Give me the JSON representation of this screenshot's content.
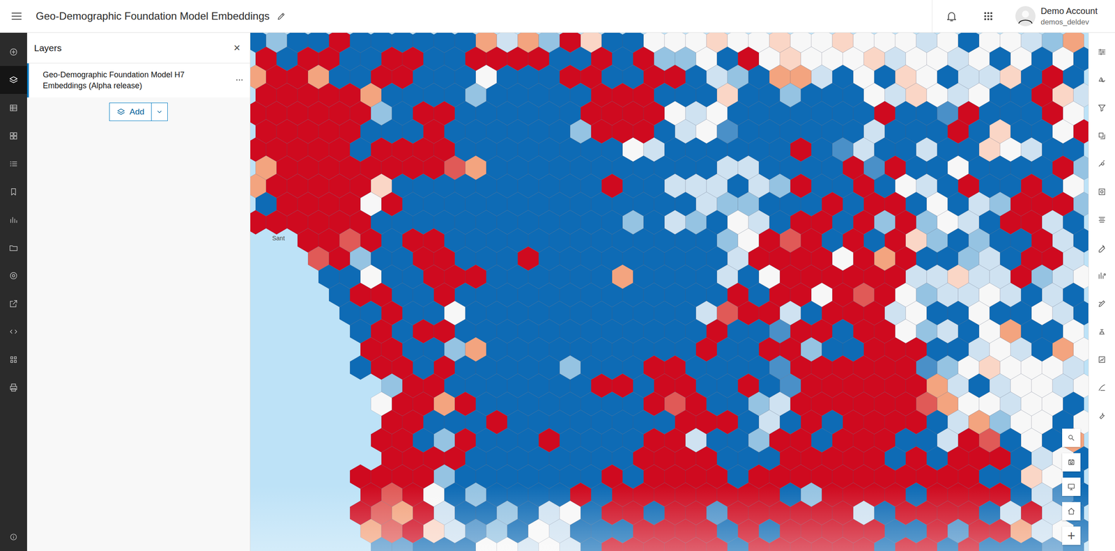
{
  "header": {
    "title": "Geo-Demographic Foundation Model Embeddings",
    "account_name": "Demo Account",
    "account_user": "demos_deldev"
  },
  "left_tools": [
    {
      "selected": false
    },
    {
      "selected": true
    },
    {
      "selected": false
    },
    {
      "selected": false
    },
    {
      "selected": false
    },
    {
      "selected": false
    },
    {
      "selected": false
    },
    {
      "selected": false
    },
    {
      "selected": false
    },
    {
      "selected": false
    },
    {
      "selected": false
    },
    {
      "selected": false
    },
    {
      "selected": false
    }
  ],
  "layers_panel": {
    "title": "Layers",
    "close": "×",
    "layers": [
      {
        "name": "Geo-Demographic Foundation Model H7 Embeddings (Alpha release)",
        "selected": true
      }
    ],
    "add_button": "Add"
  },
  "map": {
    "water": "~",
    "palette": {
      "R": "#cf0a1f",
      "r": "#e05a57",
      "o": "#f3a47f",
      "p": "#fad6c6",
      "w": "#f7f7f7",
      "l": "#cfe2f1",
      "m": "#95c3e2",
      "s": "#4a90c8",
      "B": "#0e6bb5"
    },
    "labels": [
      "Sant"
    ],
    "hex_rows": [
      "BmBBRBBBBBBolomRpBBwwwpwwpwwpwwwlwBwwlmo",
      "RBRRBBRRBBRRRRBBRBRmmwBRwpwwwplwwlwBwBwB",
      "oRRoBBRRBBBwBBBRRBBRRBlmBoolBwBpwBllpBRB",
      "RRRRRoBBBBmBBBBBRRRBBBpBBmBBBwlpwlwBBRpl",
      "RRRRRRmBRRBBBBBBRRRRwlwBBBBBBBRBBsRBBBRw",
      "RRRRRBBBRBBBBBBmRRRBlwsBBBBBBlBBBRBpBBwR",
      "RRRRRBRRRRBBBBBBBBwlBBBBBBRBslBBlBBpwlBB",
      "oRRRRRRRRroBBBBBBBBBBBllBBBBRsRBBwBBBBRm",
      "oRRRRRpBBBBBBBBBBRBBlllBlmRBBRBwlBRBBRBw",
      "BRRRRwRBBBBBBBBBBBBBBlmmBBBRBRRBwBlmRRRm",
      "RRRRRRBBBBBBBBBBBBmBlmBwlBRRBRmRmwlBRRlB",
      "~~RRrRBRRBBBBBBBBBBBBBmwRrRBRBRpmBmBBRlB",
      "~~~rRmBBRRBBBRBBBBBBBBBlRRRRwRoRBBmlBRRl",
      "~~~BBwBBRRRBBBBBBoBBBBlBwRRRRRRllpllRmlw",
      "~~~~BRRBBRBBBBBBBBBBBBBRBRRwRrRwmllwlBlB",
      "~~~~BBRBBwBBBBBBBBBBBlrRRlBRRRlwBBwBBwlB",
      "~~~~~BRBRRBBBBBBBBBBBBRBBsRRBRRwmlBwoBBw",
      "~~~~~RRBBmoBBBBBBBBBBRBBRRmBBRRRBBlwlBow",
      "~~~~~BRRBRBBBBBmBBBRRBBBBsRRRRRRsmwpwwwl",
      "~~~~~~mRRBBBBBBBRRBRRBBRBsRRRRRRolBlwwlw",
      "~~~~~~wRRoRBBBBBBBBRrRBBmlRRRRRRrowwlwwB",
      "~~~~~~RRBBBRBBBBBBBBRRRBlBRBRRRRBlomwwBw",
      "~~~~~~RRBmRBBBRBBBBRRlBBmRRBRRRBBlRrBwBo",
      "~~~~~~RRRRBBBBBBBBRRRRBBBRRRRRBRBRRRBlwB",
      "~~~~~RRRRmBBBBBBBRBRRRRBRRRRRRRRRRRBBpwB",
      "~~~~~RrRwBmBBBBRBRRRRRRRRBmRRRRBRRRRBlsB",
      "~~~~~RroRlBBmBlwBRRBRRsRRRRRRlBRRRRBlRlB",
      "~~~~~orRplsmBwlBBBRRRRBRBRRRRRBBRsRRolwB",
      "~~~~~~ssBBBwwlwlBRRRRRRBRRRRRRBRRBRBBBsB",
      "~~~~~~sBBBlwlBlwBBRRRRRBRRRRBRBRRBBBBBsB"
    ]
  },
  "map_controls": {
    "zoom_in": "+"
  }
}
